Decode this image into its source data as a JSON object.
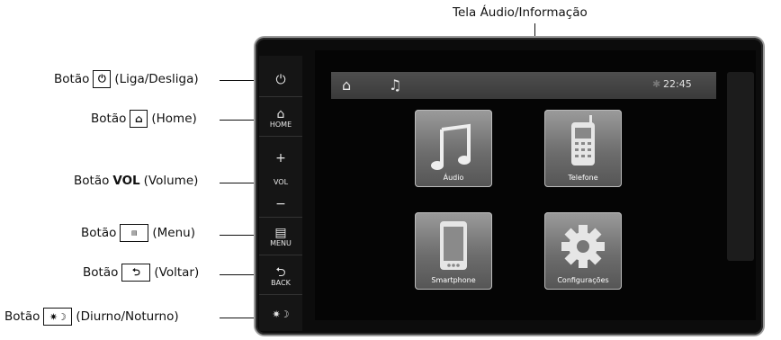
{
  "title_label": "Tela Áudio/Informação",
  "callouts": {
    "power": {
      "prefix": "Botão",
      "suffix": "(Liga/Desliga)"
    },
    "home": {
      "prefix": "Botão",
      "suffix": "(Home)"
    },
    "volume": {
      "prefix": "Botão",
      "bold": "VOL",
      "suffix": "(Volume)"
    },
    "menu": {
      "prefix": "Botão",
      "suffix": "(Menu)"
    },
    "back": {
      "prefix": "Botão",
      "suffix": "(Voltar)"
    },
    "daynight": {
      "prefix": "Botão",
      "suffix": "(Diurno/Noturno)"
    }
  },
  "hardware": {
    "home_label": "HOME",
    "vol_label": "VOL",
    "menu_label": "MENU",
    "back_label": "BACK"
  },
  "screen": {
    "clock": "22:45",
    "tiles": [
      "Áudio",
      "Telefone",
      "Smartphone",
      "Configurações"
    ]
  }
}
